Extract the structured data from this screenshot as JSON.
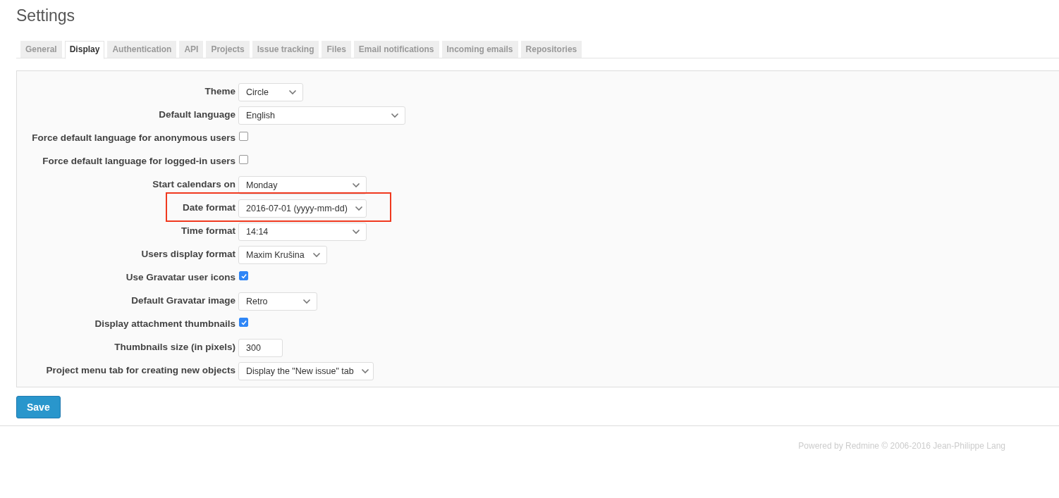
{
  "page": {
    "title": "Settings"
  },
  "tabs": [
    {
      "label": "General",
      "selected": false
    },
    {
      "label": "Display",
      "selected": true
    },
    {
      "label": "Authentication",
      "selected": false
    },
    {
      "label": "API",
      "selected": false
    },
    {
      "label": "Projects",
      "selected": false
    },
    {
      "label": "Issue tracking",
      "selected": false
    },
    {
      "label": "Files",
      "selected": false
    },
    {
      "label": "Email notifications",
      "selected": false
    },
    {
      "label": "Incoming emails",
      "selected": false
    },
    {
      "label": "Repositories",
      "selected": false
    }
  ],
  "settings": [
    {
      "kind": "select",
      "label": "Theme",
      "value": "Circle",
      "highlighted": false
    },
    {
      "kind": "select",
      "label": "Default language",
      "value": "English",
      "highlighted": false
    },
    {
      "kind": "checkbox",
      "label": "Force default language for anonymous users",
      "checked": false,
      "highlighted": false
    },
    {
      "kind": "checkbox",
      "label": "Force default language for logged-in users",
      "checked": false,
      "highlighted": false
    },
    {
      "kind": "select",
      "label": "Start calendars on",
      "value": "Monday",
      "highlighted": false
    },
    {
      "kind": "select",
      "label": "Date format",
      "value": "2016-07-01 (yyyy-mm-dd)",
      "highlighted": true
    },
    {
      "kind": "select",
      "label": "Time format",
      "value": "14:14",
      "highlighted": false
    },
    {
      "kind": "select",
      "label": "Users display format",
      "value": "Maxim Krušina",
      "highlighted": false
    },
    {
      "kind": "checkbox",
      "label": "Use Gravatar user icons",
      "checked": true,
      "highlighted": false
    },
    {
      "kind": "select",
      "label": "Default Gravatar image",
      "value": "Retro",
      "highlighted": false
    },
    {
      "kind": "checkbox",
      "label": "Display attachment thumbnails",
      "checked": true,
      "highlighted": false
    },
    {
      "kind": "text",
      "label": "Thumbnails size (in pixels)",
      "value": "300",
      "highlighted": false
    },
    {
      "kind": "select",
      "label": "Project menu tab for creating new objects",
      "value": "Display the \"New issue\" tab",
      "highlighted": false
    }
  ],
  "save_button": "Save",
  "footer": "Powered by Redmine © 2006-2016 Jean-Philippe Lang"
}
